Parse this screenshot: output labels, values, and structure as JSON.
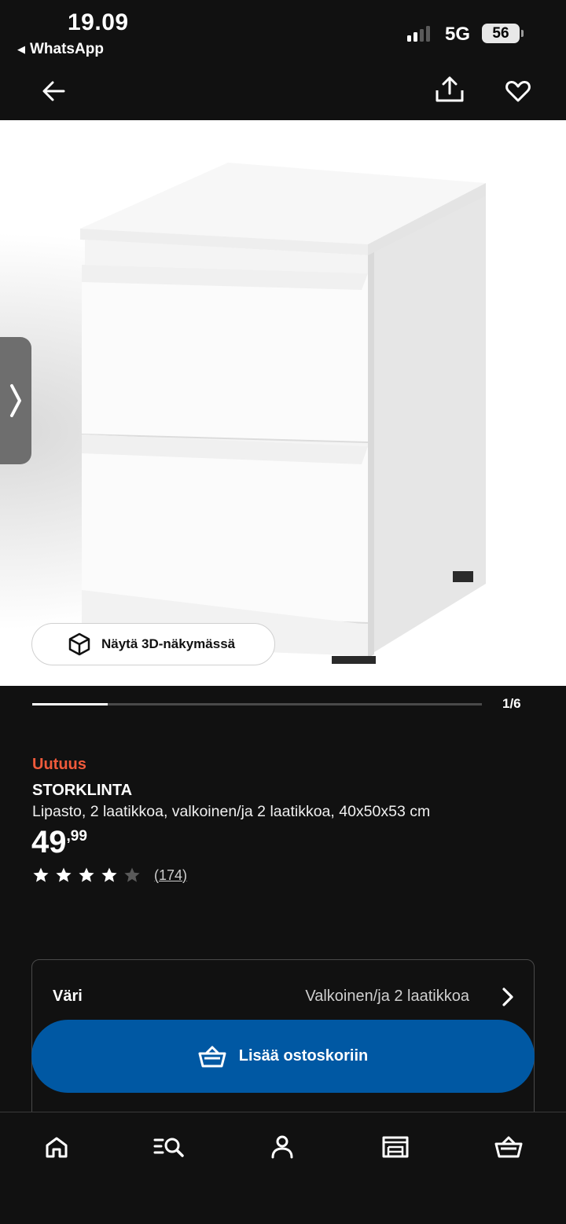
{
  "status_bar": {
    "time": "19.09",
    "back_app": "WhatsApp",
    "network": "5G",
    "battery": "56"
  },
  "topnav": {
    "back_icon": "arrow-left-icon",
    "share_icon": "share-icon",
    "favorite_icon": "heart-icon"
  },
  "gallery": {
    "view_3d_label": "Näytä 3D-näkymässä",
    "counter": "1/6",
    "progress_fraction": 0.167
  },
  "product": {
    "badge": "Uutuus",
    "name": "STORKLINTA",
    "description": "Lipasto, 2 laatikkoa, valkoinen/ja 2 laatikkoa, 40x50x53 cm",
    "price_whole": "49",
    "price_separator": ",",
    "price_cents": "99",
    "rating": 4,
    "rating_max": 5,
    "reviews": "(174)"
  },
  "options": {
    "color_label": "Väri",
    "color_value": "Valkoinen/ja 2 laatikkoa"
  },
  "cart_button": {
    "label": "Lisää ostoskoriin",
    "color": "#0058a3"
  },
  "bottom_nav": [
    "home-icon",
    "search-icon",
    "profile-icon",
    "store-icon",
    "cart-icon"
  ],
  "colors": {
    "badge": "#f05a3b",
    "background": "#111111"
  }
}
